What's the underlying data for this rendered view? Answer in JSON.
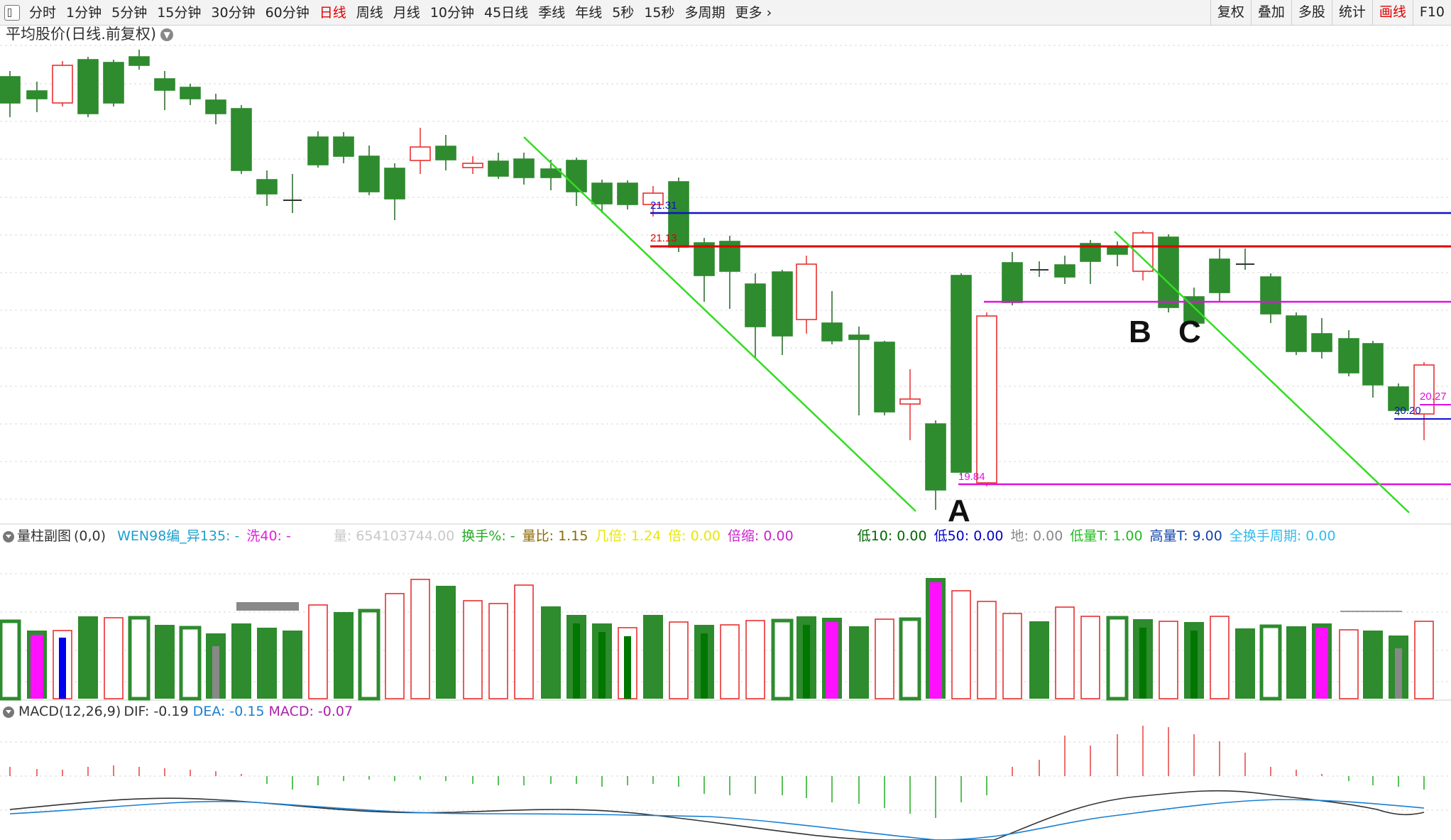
{
  "toolbar": {
    "periods": [
      "分时",
      "1分钟",
      "5分钟",
      "15分钟",
      "30分钟",
      "60分钟",
      "日线",
      "周线",
      "月线",
      "10分钟",
      "45日线",
      "季线",
      "年线",
      "5秒",
      "15秒",
      "多周期",
      "更多"
    ],
    "active_period": "日线",
    "right_buttons": [
      "复权",
      "叠加",
      "多股",
      "统计",
      "画线",
      "F10"
    ]
  },
  "main_chart": {
    "title": "平均股价(日线.前复权)",
    "level_labels": {
      "blue_line": "21.31",
      "red_line": "21.13",
      "bottom_line": "19.84",
      "right_blue": "20.20",
      "right_magenta": "20.27"
    },
    "point_labels": {
      "a": "A",
      "b": "B",
      "c": "C"
    }
  },
  "volume_panel": {
    "title": "量柱副图",
    "params": "(0,0)",
    "fields": [
      {
        "label": "WEN98编_异135: -",
        "color": "#1a9fcf"
      },
      {
        "label": "洗40: -",
        "color": "#e020e0"
      },
      {
        "label": "量: 654103744.00",
        "color": "#c8c8c8"
      },
      {
        "label": "换手%: -",
        "color": "#22aa22"
      },
      {
        "label": "量比: 1.15",
        "color": "#8a6a00"
      },
      {
        "label": "几倍: 1.24",
        "color": "#e8e800"
      },
      {
        "label": "倍: 0.00",
        "color": "#e8e800"
      },
      {
        "label": "倍缩: 0.00",
        "color": "#cc22cc"
      },
      {
        "label": "低10: 0.00",
        "color": "#006600"
      },
      {
        "label": "低50: 0.00",
        "color": "#0000cc"
      },
      {
        "label": "地: 0.00",
        "color": "#888888"
      },
      {
        "label": "低量T: 1.00",
        "color": "#22bb22"
      },
      {
        "label": "高量T: 9.00",
        "color": "#1144aa"
      },
      {
        "label": "全换手周期: 0.00",
        "color": "#33bbee"
      }
    ]
  },
  "macd_panel": {
    "title": "MACD(12,26,9)",
    "dif": "DIF: -0.19",
    "dea": "DEA: -0.15",
    "macd": "MACD: -0.07"
  },
  "colors": {
    "up": "#e83030",
    "down": "#2e8b2e",
    "trend_line": "#33dd22",
    "blue_level": "#1010c8",
    "red_level": "#e00000",
    "magenta_level": "#e010e0"
  }
}
